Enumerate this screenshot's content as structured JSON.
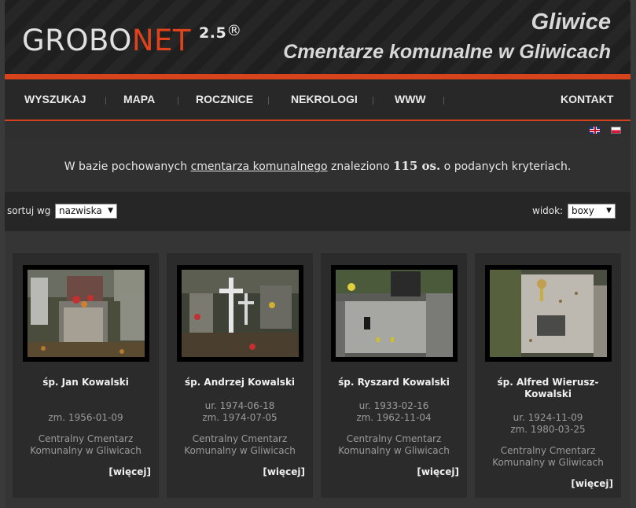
{
  "header": {
    "logo_a": "GROBO",
    "logo_b": "NET",
    "version": "2.5",
    "registered": "®",
    "city": "Gliwice",
    "subtitle": "Cmentarze komunalne w Gliwicach"
  },
  "nav": {
    "items": [
      {
        "label": "WYSZUKAJ"
      },
      {
        "label": "MAPA"
      },
      {
        "label": "ROCZNICE"
      },
      {
        "label": "NEKROLOGI"
      },
      {
        "label": "WWW"
      },
      {
        "label": "KONTAKT"
      }
    ]
  },
  "flags": [
    "flag-en-icon",
    "flag-pl-icon"
  ],
  "info": {
    "prefix": "W bazie pochowanych ",
    "link": "cmentarza komunalnego",
    "mid": " znaleziono ",
    "count": "115 os.",
    "suffix": " o podanych kryteriach."
  },
  "sortbar": {
    "sort_label": "sortuj wg",
    "sort_value": "nazwiska",
    "view_label": "widok:",
    "view_value": "boxy"
  },
  "cards": [
    {
      "name": "śp. Jan Kowalski",
      "born": "",
      "died": "zm. 1956-01-09",
      "place": "Centralny Cmentarz Komunalny w Gliwicach",
      "more": "[więcej]"
    },
    {
      "name": "śp. Andrzej Kowalski",
      "born": "ur. 1974-06-18",
      "died": "zm. 1974-07-05",
      "place": "Centralny Cmentarz Komunalny w Gliwicach",
      "more": "[więcej]"
    },
    {
      "name": "śp. Ryszard Kowalski",
      "born": "ur. 1933-02-16",
      "died": "zm. 1962-11-04",
      "place": "Centralny Cmentarz Komunalny w Gliwicach",
      "more": "[więcej]"
    },
    {
      "name": "śp. Alfred Wierusz-Kowalski",
      "born": "ur. 1924-11-09",
      "died": "zm. 1980-03-25",
      "place": "Centralny Cmentarz Komunalny w Gliwicach",
      "more": "[więcej]"
    }
  ],
  "colors": {
    "accent": "#d7431a",
    "background": "#2f2f2f"
  }
}
